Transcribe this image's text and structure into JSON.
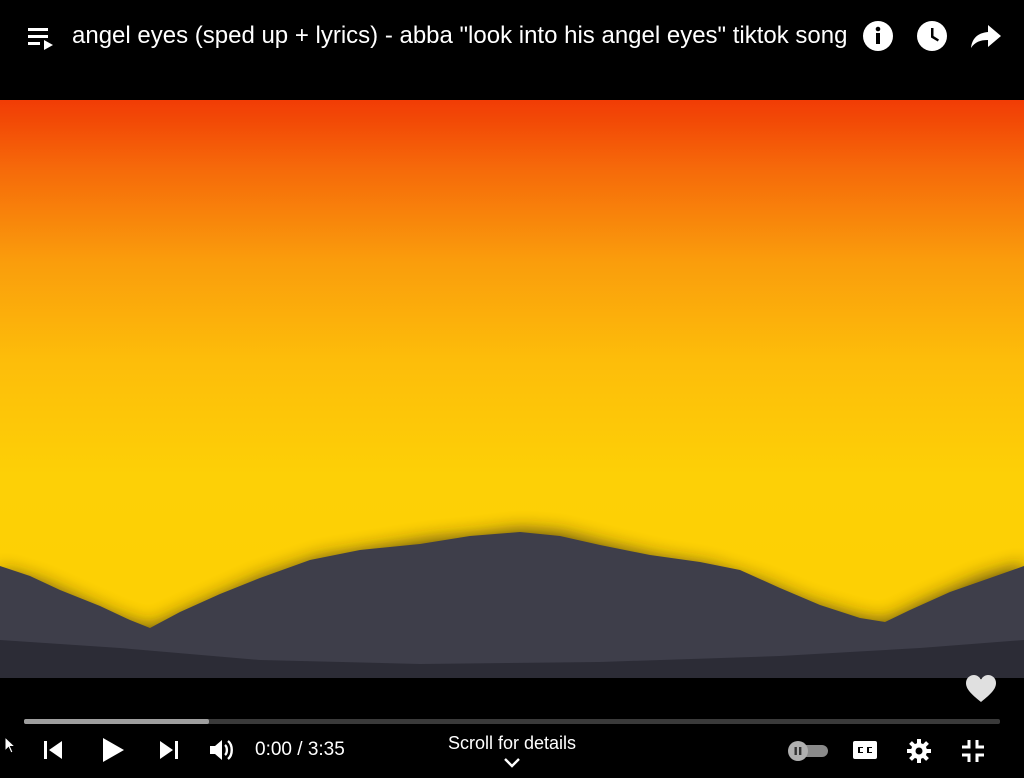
{
  "header": {
    "title": "angel eyes (sped up + lyrics) - abba \"look into his angel eyes\" tiktok song",
    "icons": [
      "playlist-icon",
      "info-icon",
      "watch-later-icon",
      "share-icon"
    ]
  },
  "player": {
    "progress_loaded_fraction": 0.19,
    "progress_played_fraction": 0.0,
    "time_display": "0:00 / 3:35",
    "scroll_hint": "Scroll for details",
    "autoplay_on": false,
    "icons": [
      "heart-icon",
      "previous-icon",
      "play-icon",
      "next-icon",
      "volume-icon",
      "autoplay-toggle",
      "cc-icon",
      "settings-icon",
      "exit-fullscreen-icon"
    ]
  },
  "colors": {
    "sky_top": "#f13c05",
    "sky_bottom": "#fdd002",
    "mountain": "#3e3e4a",
    "background": "#000000"
  }
}
